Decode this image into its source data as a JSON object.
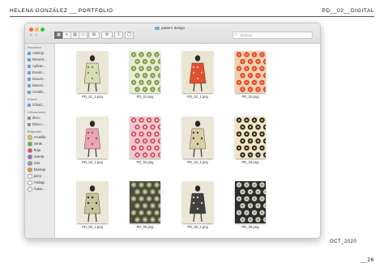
{
  "page": {
    "header_left": "HELENA GONZÁLEZ __ PORTFOLIO",
    "header_right": "PD__02__DIGITAL",
    "footer_date": "OCT_2020",
    "footer_page": "__26"
  },
  "window": {
    "title": "pattern design",
    "search_placeholder": "Buscar",
    "back_label": "‹",
    "forward_label": "›",
    "view_icons": [
      "grid-view-icon",
      "list-view-icon",
      "column-view-icon",
      "gallery-view-icon"
    ],
    "group_label": "⊞",
    "action_label": "⚙",
    "share_label": "⇪",
    "tag_label": "◯"
  },
  "sidebar": {
    "favorites_label": "Favoritos",
    "favorites": [
      {
        "label": "AirDrop",
        "icon": "airdrop-icon"
      },
      {
        "label": "Recient...",
        "icon": "recents-icon"
      },
      {
        "label": "Aplicac...",
        "icon": "applications-icon"
      },
      {
        "label": "Escrito...",
        "icon": "desktop-icon"
      },
      {
        "label": "Docum...",
        "icon": "documents-icon"
      },
      {
        "label": "Descar...",
        "icon": "downloads-icon"
      },
      {
        "label": "Creativ...",
        "icon": "cloud-folder-icon"
      }
    ],
    "icloud_label": "iCloud",
    "icloud": [
      {
        "label": "iCloud...",
        "icon": "icloud-icon"
      }
    ],
    "locations_label": "Ubicaciones",
    "locations": [
      {
        "label": "disco",
        "icon": "disk-icon"
      },
      {
        "label": "Disco r...",
        "icon": "remote-disk-icon"
      }
    ],
    "tags_label": "Etiquetas",
    "tags": [
      {
        "label": "Amarilla",
        "color": "#f2c318"
      },
      {
        "label": "Verde",
        "color": "#4cbb4c"
      },
      {
        "label": "Roja",
        "color": "#f04a42"
      },
      {
        "label": "Violeta",
        "color": "#a45fc9"
      },
      {
        "label": "Gris",
        "color": "#9a9a9a"
      },
      {
        "label": "Naranja",
        "color": "#f58e24"
      },
      {
        "label": "perry",
        "color": "#ffffff"
      },
      {
        "label": "Trabajo",
        "color": "#ffffff"
      },
      {
        "label": "Todas...",
        "color": "#ffffff"
      }
    ]
  },
  "files": [
    {
      "name": "PD_01_1.png",
      "kind": "figure",
      "bg": "#ebe6d6",
      "accent": "#d8dcb7",
      "accent2": "#7a8f4a"
    },
    {
      "name": "PD_01.png",
      "kind": "pattern",
      "bg": "#e8ecd0",
      "accent": "#7f9a4e",
      "accent2": "#c9d59a"
    },
    {
      "name": "PD_02_1.png",
      "kind": "figure",
      "bg": "#ebe4cf",
      "accent": "#e0502e",
      "accent2": "#f0b39a"
    },
    {
      "name": "PD_02.png",
      "kind": "pattern",
      "bg": "#f0d0b0",
      "accent": "#e24a2b",
      "accent2": "#f6a06e"
    },
    {
      "name": "PD_03_1.png",
      "kind": "figure",
      "bg": "#efe9dc",
      "accent": "#e9a6b4",
      "accent2": "#b8466a"
    },
    {
      "name": "PD_03.png",
      "kind": "pattern",
      "bg": "#f1c9cf",
      "accent": "#d64d61",
      "accent2": "#f5e6e2"
    },
    {
      "name": "PD_04_1.png",
      "kind": "figure",
      "bg": "#ece6d6",
      "accent": "#d9cfa6",
      "accent2": "#333333"
    },
    {
      "name": "PD_04.png",
      "kind": "pattern",
      "bg": "#f2e4c4",
      "accent": "#222222",
      "accent2": "#e6c98a"
    },
    {
      "name": "PD_05_1.png",
      "kind": "figure",
      "bg": "#ece6d6",
      "accent": "#c7c49a",
      "accent2": "#2b2b2b"
    },
    {
      "name": "PD_05.png",
      "kind": "pattern",
      "bg": "#4c4d3e",
      "accent": "#9ba073",
      "accent2": "#d7d7b5"
    },
    {
      "name": "PD_06_1.png",
      "kind": "figure",
      "bg": "#ebe6d6",
      "accent": "#404040",
      "accent2": "#d8d4b4"
    },
    {
      "name": "PD_06.png",
      "kind": "pattern",
      "bg": "#2c2c2c",
      "accent": "#d5d5c0",
      "accent2": "#8a8a70"
    }
  ]
}
